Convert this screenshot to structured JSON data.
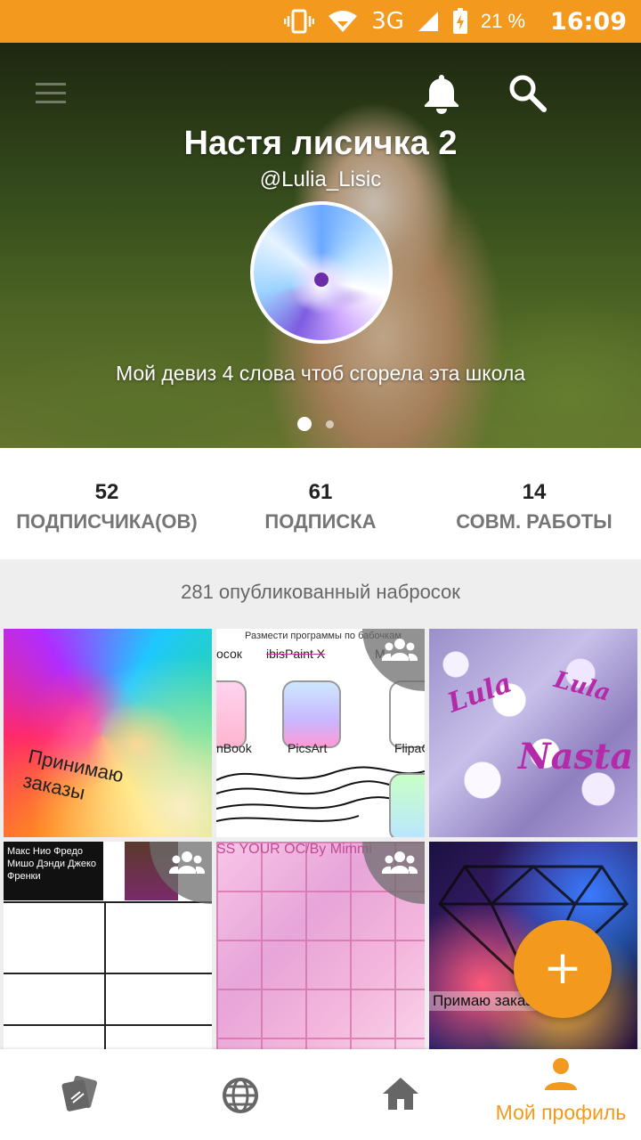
{
  "status_bar": {
    "network": "3G",
    "battery_percent": "21 %",
    "time": "16:09"
  },
  "header": {
    "name": "Настя лисичка 2",
    "handle": "@Lulia_Lisic",
    "motto": "Мой девиз 4 слова чтоб сгорела эта школа",
    "carousel_pages": 2,
    "carousel_active": 1
  },
  "stats": [
    {
      "value": "52",
      "label": "ПОДПИСЧИКА(ОВ)"
    },
    {
      "value": "61",
      "label": "ПОДПИСКА"
    },
    {
      "value": "14",
      "label": "СОВМ. РАБОТЫ"
    }
  ],
  "published_label": "281 опубликованный набросок",
  "tiles": {
    "t1": {
      "text_line1": "Принимаю",
      "text_line2": "заказы"
    },
    "t2": {
      "header": "Размести программы по бабочкам",
      "labels": [
        "осок",
        "ibisPaint X",
        "M",
        "nBook",
        "PicsArt",
        "FlipaC"
      ]
    },
    "t3": {
      "sig1": "Lula",
      "sig2": "Nasta"
    },
    "t4": {
      "text": "Макс Нио Фредо Мишо Дэнди Джеко Френки"
    },
    "t5": {
      "title": "SS YOUR OC/By Mimmi"
    },
    "t6": {
      "text": "Примаю заказ"
    }
  },
  "fab": {
    "label": "+"
  },
  "bottom_nav": {
    "items": [
      {
        "icon": "cards-icon"
      },
      {
        "icon": "globe-icon"
      },
      {
        "icon": "home-icon"
      },
      {
        "icon": "person-icon",
        "label": "Мой профиль",
        "active": true
      }
    ]
  },
  "colors": {
    "accent": "#f39a1e",
    "label_gray": "#757575"
  }
}
